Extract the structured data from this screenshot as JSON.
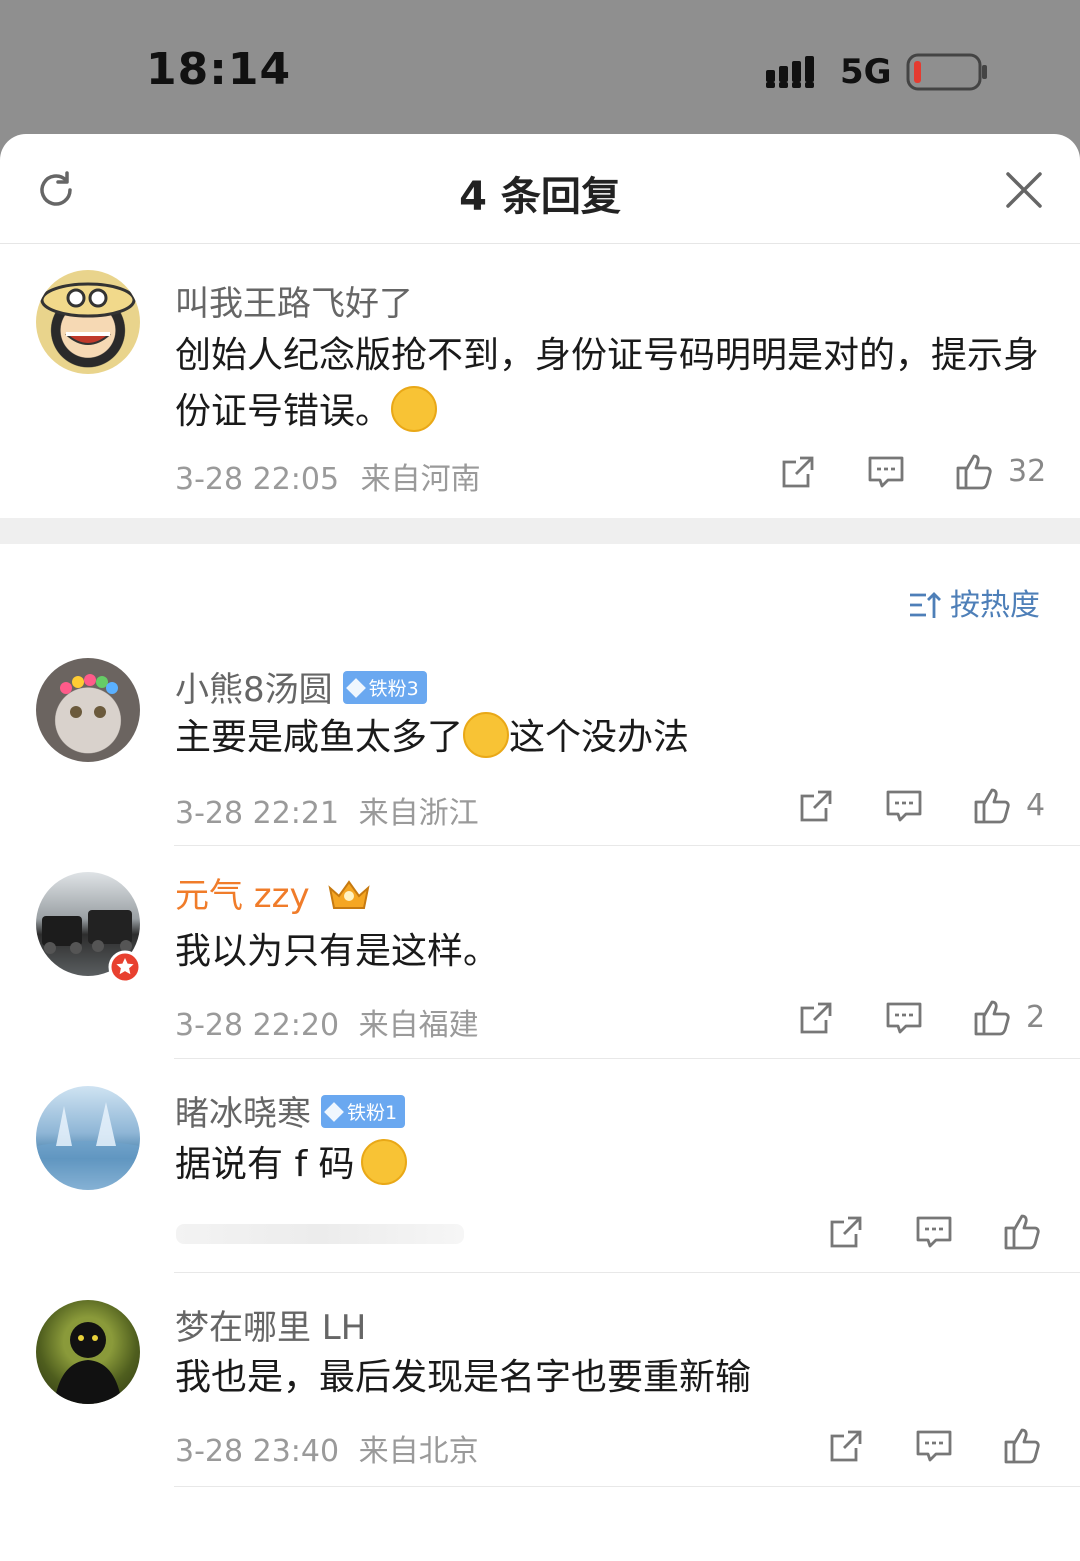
{
  "status_bar": {
    "time": "18:14",
    "network": "5G",
    "battery_color": "#e53b30"
  },
  "header": {
    "title": "4 条回复",
    "refresh_icon": "refresh-icon",
    "close_icon": "close-icon"
  },
  "main_comment": {
    "username": "叫我王路飞好了",
    "text": "创始人纪念版抢不到，身份证号码明明是对的，提示身份证号错误。",
    "emoji": "crying-emoji",
    "time": "3-28 22:05",
    "location": "来自河南",
    "likes": "32"
  },
  "sort": {
    "label": "按热度"
  },
  "replies": [
    {
      "username": "小熊8汤圆",
      "badge": "铁粉3",
      "text_before": "主要是咸鱼太多了",
      "emoji": "laugh-cry-emoji",
      "text_after": "这个没办法",
      "time": "3-28 22:21",
      "location": "来自浙江",
      "likes": "4"
    },
    {
      "username": "元气 zzy",
      "text": "我以为只有是这样。",
      "time": "3-28 22:20",
      "location": "来自福建",
      "likes": "2"
    },
    {
      "username": "睹冰晓寒",
      "badge": "铁粉1",
      "text": "据说有 f 码",
      "emoji": "laughing-emoji"
    },
    {
      "username": "梦在哪里 LH",
      "text": "我也是，最后发现是名字也要重新输",
      "time": "3-28 23:40",
      "location": "来自北京"
    }
  ],
  "colors": {
    "accent": "#4e7fb8",
    "vip_name": "#f07c2a",
    "badge": "#6aa8f0"
  }
}
